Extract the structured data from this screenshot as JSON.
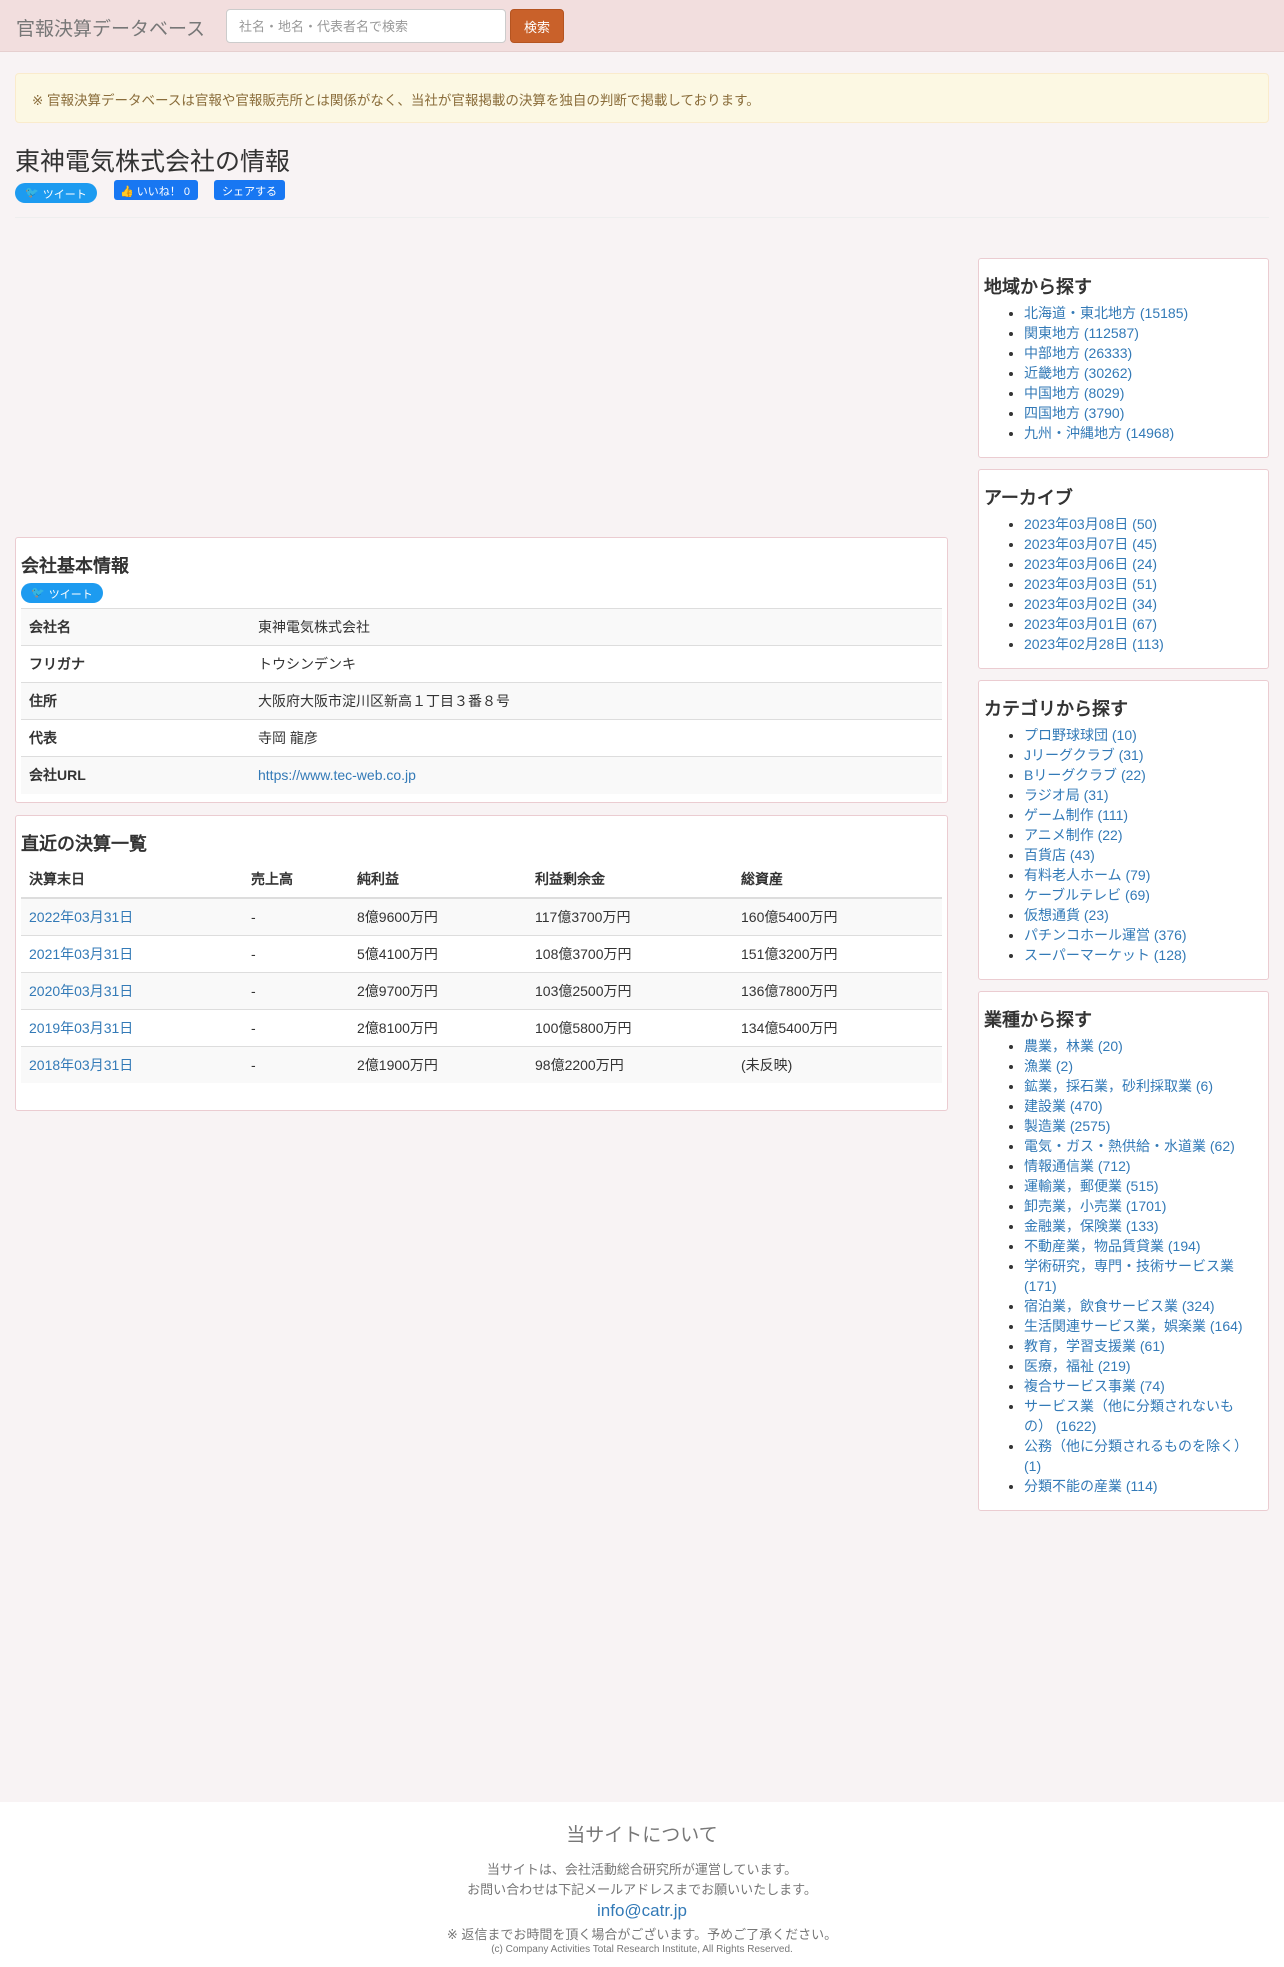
{
  "navbar": {
    "brand": "官報決算データベース",
    "search_placeholder": "社名・地名・代表者名で検索",
    "search_button": "検索"
  },
  "notice": "※ 官報決算データベースは官報や官報販売所とは関係がなく、当社が官報掲載の決算を独自の判断で掲載しております。",
  "page": {
    "title": "東神電気株式会社の情報",
    "tweet": "ツイート",
    "like": "いいね！ 0",
    "share": "シェアする"
  },
  "company": {
    "heading": "会社基本情報",
    "tweet": "ツイート",
    "rows": [
      {
        "label": "会社名",
        "value": "東神電気株式会社"
      },
      {
        "label": "フリガナ",
        "value": "トウシンデンキ"
      },
      {
        "label": "住所",
        "value": "大阪府大阪市淀川区新高１丁目３番８号"
      },
      {
        "label": "代表",
        "value": "寺岡 龍彦"
      },
      {
        "label": "会社URL",
        "value": "https://www.tec-web.co.jp"
      }
    ]
  },
  "financials": {
    "heading": "直近の決算一覧",
    "columns": [
      "決算末日",
      "売上高",
      "純利益",
      "利益剰余金",
      "総資産"
    ],
    "rows": [
      [
        "2022年03月31日",
        "-",
        "8億9600万円",
        "117億3700万円",
        "160億5400万円"
      ],
      [
        "2021年03月31日",
        "-",
        "5億4100万円",
        "108億3700万円",
        "151億3200万円"
      ],
      [
        "2020年03月31日",
        "-",
        "2億9700万円",
        "103億2500万円",
        "136億7800万円"
      ],
      [
        "2019年03月31日",
        "-",
        "2億8100万円",
        "100億5800万円",
        "134億5400万円"
      ],
      [
        "2018年03月31日",
        "-",
        "2億1900万円",
        "98億2200万円",
        "(未反映)"
      ]
    ]
  },
  "sidebar": {
    "regions": {
      "heading": "地域から探す",
      "items": [
        "北海道・東北地方 (15185)",
        "関東地方 (112587)",
        "中部地方 (26333)",
        "近畿地方 (30262)",
        "中国地方 (8029)",
        "四国地方 (3790)",
        "九州・沖縄地方 (14968)"
      ]
    },
    "archive": {
      "heading": "アーカイブ",
      "items": [
        "2023年03月08日 (50)",
        "2023年03月07日 (45)",
        "2023年03月06日 (24)",
        "2023年03月03日 (51)",
        "2023年03月02日 (34)",
        "2023年03月01日 (67)",
        "2023年02月28日 (113)"
      ]
    },
    "categories": {
      "heading": "カテゴリから探す",
      "items": [
        "プロ野球球団 (10)",
        "Jリーグクラブ (31)",
        "Bリーグクラブ (22)",
        "ラジオ局 (31)",
        "ゲーム制作 (111)",
        "アニメ制作 (22)",
        "百貨店 (43)",
        "有料老人ホーム (79)",
        "ケーブルテレビ (69)",
        "仮想通貨 (23)",
        "パチンコホール運営 (376)",
        "スーパーマーケット (128)"
      ]
    },
    "industries": {
      "heading": "業種から探す",
      "items": [
        "農業，林業 (20)",
        "漁業 (2)",
        "鉱業，採石業，砂利採取業 (6)",
        "建設業 (470)",
        "製造業 (2575)",
        "電気・ガス・熱供給・水道業 (62)",
        "情報通信業 (712)",
        "運輸業，郵便業 (515)",
        "卸売業，小売業 (1701)",
        "金融業，保険業 (133)",
        "不動産業，物品賃貸業 (194)",
        "学術研究，専門・技術サービス業 (171)",
        "宿泊業，飲食サービス業 (324)",
        "生活関連サービス業，娯楽業 (164)",
        "教育，学習支援業 (61)",
        "医療，福祉 (219)",
        "複合サービス事業 (74)",
        "サービス業（他に分類されないもの） (1622)",
        "公務（他に分類されるものを除く） (1)",
        "分類不能の産業 (114)"
      ]
    }
  },
  "footer": {
    "title": "当サイトについて",
    "line1": "当サイトは、会社活動総合研究所が運営しています。",
    "line2": "お問い合わせは下記メールアドレスまでお願いいたします。",
    "email": "info@catr.jp",
    "note": "※ 返信までお時間を頂く場合がございます。予めご了承ください。",
    "copyright": "(c) Company Activities Total Research Institute, All Rights Reserved."
  }
}
